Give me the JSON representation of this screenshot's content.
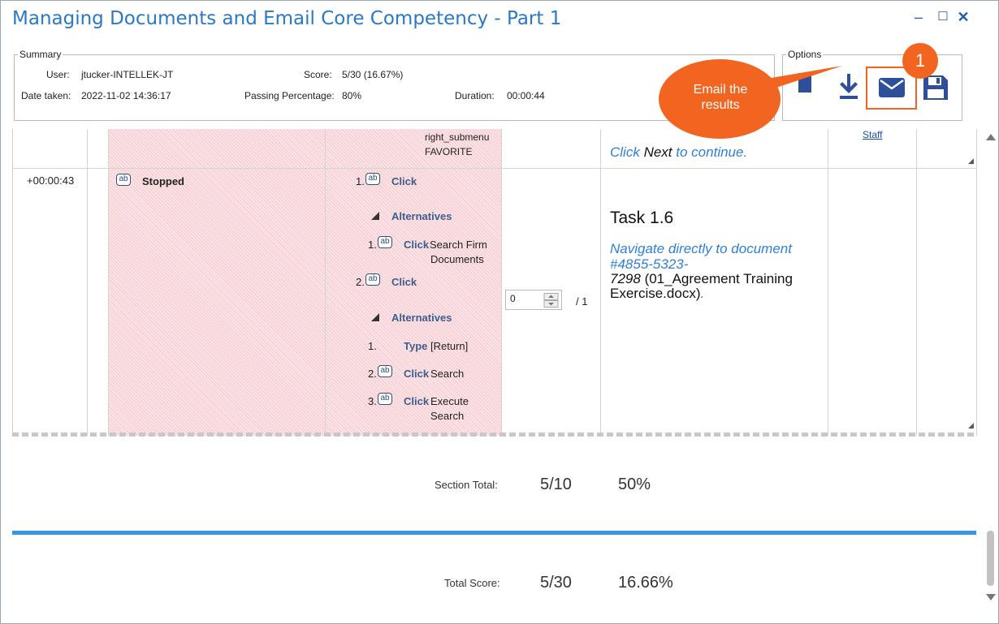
{
  "window": {
    "title": "Managing Documents and Email Core Competency - Part 1",
    "controls": {
      "minimize": "–",
      "maximize": "☐",
      "close": "✕"
    }
  },
  "summary": {
    "legend": "Summary",
    "user_label": "User:",
    "user_value": "jtucker-INTELLEK-JT",
    "score_label": "Score:",
    "score_value": "5/30 (16.67%)",
    "date_label": "Date taken:",
    "date_value": "2022-11-02 14:36:17",
    "passing_label": "Passing Percentage:",
    "passing_value": "80%",
    "duration_label": "Duration:",
    "duration_value": "00:00:44"
  },
  "options": {
    "legend": "Options",
    "icons": [
      "document-icon",
      "download-icon",
      "email-icon",
      "save-icon"
    ]
  },
  "callout": {
    "text_line1": "Email the",
    "text_line2": "results",
    "badge": "1",
    "color": "#f26521"
  },
  "rows": {
    "prev": {
      "step_line1": "right_submenu",
      "step_line2": "FAVORITE",
      "staff_link": "Staff",
      "instruction_click": "Click",
      "instruction_next": "Next",
      "instruction_rest": "to continue."
    },
    "current": {
      "time": "+00:00:43",
      "ab_icon": "ab",
      "status": "Stopped",
      "steps": [
        {
          "num": "1.",
          "action": "Click",
          "target": ""
        },
        {
          "num": "",
          "action": "Alternatives",
          "target": ""
        },
        {
          "num": "1.",
          "action": "Click",
          "target": "Search Firm",
          "target2": "Documents"
        },
        {
          "num": "2.",
          "action": "Click",
          "target": ""
        },
        {
          "num": "",
          "action": "Alternatives",
          "target": ""
        },
        {
          "num": "1.",
          "action": "Type",
          "target": "[Return]"
        },
        {
          "num": "2.",
          "action": "Click",
          "target": "Search"
        },
        {
          "num": "3.",
          "action": "Click",
          "target": "Execute",
          "target2": "Search"
        }
      ],
      "score_input": "0",
      "score_max": "/ 1",
      "task_title": "Task 1.6",
      "task_line1": "Navigate directly to document",
      "task_line2": "#4855-5323-",
      "task_line3a": "7298",
      "task_line3b": "(01_Agreement Training",
      "task_line4a": "Exercise.docx)",
      "task_line4b": "."
    }
  },
  "section_total": {
    "label": "Section Total:",
    "score": "5/10",
    "percent": "50%"
  },
  "total_score": {
    "label": "Total Score:",
    "score": "5/30",
    "percent": "16.66%"
  },
  "colors": {
    "title": "#2b78c5",
    "accent": "#3496e6",
    "callout": "#f26521",
    "icon": "#2e4f9a"
  }
}
